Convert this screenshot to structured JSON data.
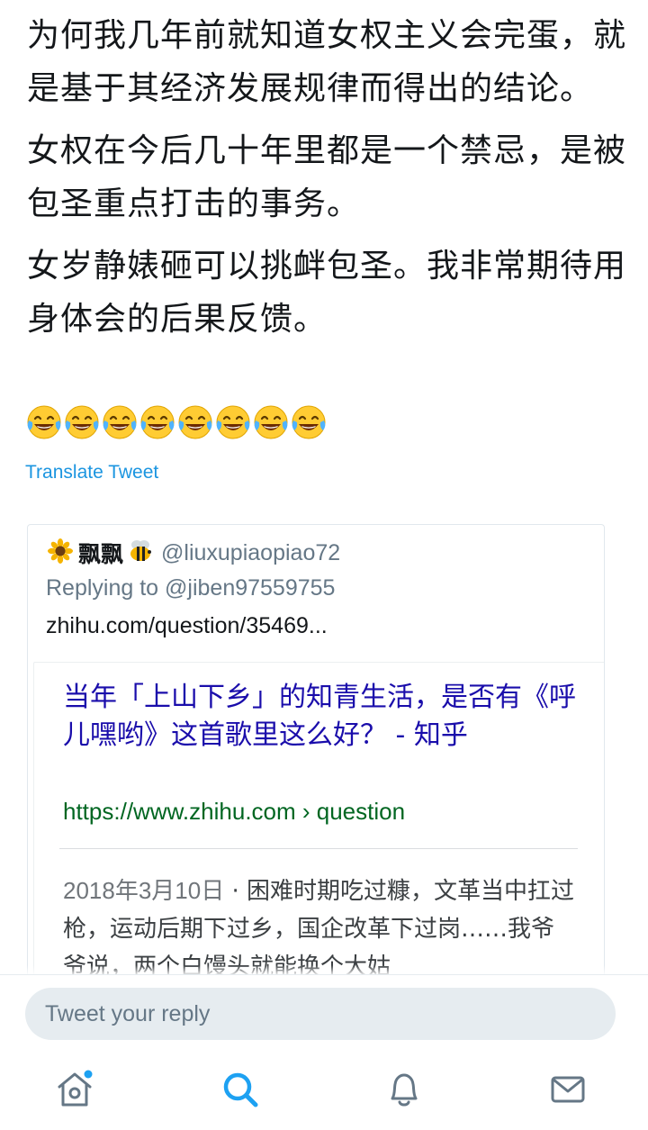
{
  "tweet": {
    "paragraphs": [
      "为何我几年前就知道女权主义会完蛋，就是基于其经济发展规律而得出的结论。",
      "女权在今后几十年里都是一个禁忌，是被包圣重点打击的事务。",
      "女岁静婊砸可以挑衅包圣。我非常期待用身体会的后果反馈。"
    ],
    "emoji": [
      "face-with-tears-of-joy",
      "face-with-tears-of-joy",
      "face-with-tears-of-joy",
      "face-with-tears-of-joy",
      "face-with-tears-of-joy",
      "face-with-tears-of-joy",
      "face-with-tears-of-joy",
      "face-with-tears-of-joy"
    ],
    "translate_label": "Translate Tweet"
  },
  "quoted_tweet": {
    "name_emoji_left": "sunflower",
    "name": "飘飘",
    "name_emoji_right": "honeybee",
    "handle": "@liuxupiaopiao72",
    "replying_to": "Replying to @jiben97559755",
    "link_text": "zhihu.com/question/35469...",
    "screenshot": {
      "title": "当年「上山下乡」的知青生活，是否有《呼儿嘿哟》这首歌里这么好？ - 知乎",
      "url": "https://www.zhihu.com › question",
      "date": "2018年3月10日",
      "snippet": " · 困难时期吃过糠，文革当中扛过枪，运动后期下过乡，国企改革下过岗……我爷爷说，两个白馒头就能换个大姑"
    }
  },
  "reply_bar": {
    "placeholder": "Tweet your reply"
  },
  "tab_bar": {
    "tabs": [
      "home-icon",
      "search-icon",
      "notifications-icon",
      "messages-icon"
    ],
    "active_color": "#1da1f2",
    "inactive_color": "#657786"
  }
}
